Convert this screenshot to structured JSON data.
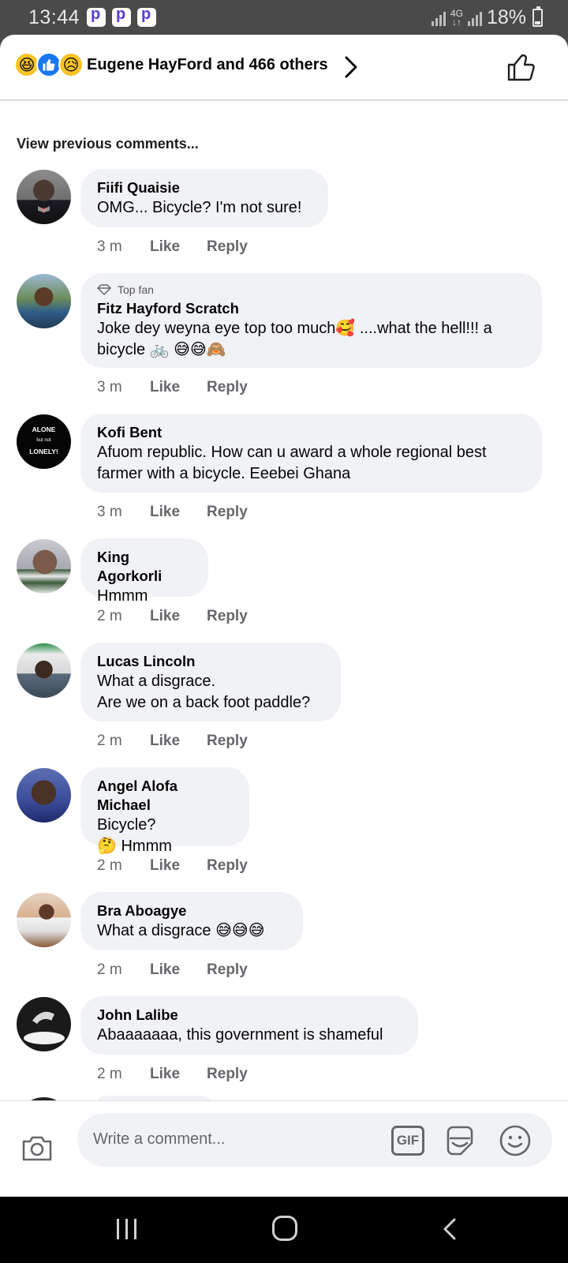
{
  "status_bar": {
    "time": "13:44",
    "network": "4G",
    "battery": "18%",
    "notification_icons": [
      "p-app-icon",
      "p-app-icon",
      "p-app-icon"
    ]
  },
  "reactions": {
    "emoji_icons": [
      "laugh-reaction-icon",
      "like-reaction-icon",
      "sad-reaction-icon"
    ],
    "summary": "Eugene HayFord and 466 others"
  },
  "view_previous": "View previous comments...",
  "comments": [
    {
      "name": "Fiifi Quaisie",
      "text": "OMG... Bicycle? I'm not sure!",
      "time": "3 m",
      "like": "Like",
      "reply": "Reply"
    },
    {
      "badge": "Top fan",
      "name": "Fitz Hayford Scratch",
      "text": "Joke dey weyna eye top too much🥰 ....what the hell!!! a bicycle 🚲 😅😅🙈",
      "time": "3 m",
      "like": "Like",
      "reply": "Reply"
    },
    {
      "name": "Kofi Bent",
      "text": "Afuom republic. How can u award a whole regional best farmer with a bicycle. Eeebei Ghana",
      "time": "3 m",
      "like": "Like",
      "reply": "Reply",
      "avatar_text": [
        "ALONE",
        "but not",
        "LONELY!"
      ]
    },
    {
      "name": "King Agorkorli",
      "text": "Hmmm",
      "time": "2 m",
      "like": "Like",
      "reply": "Reply"
    },
    {
      "name": "Lucas Lincoln",
      "text_lines": [
        "What a disgrace.",
        "Are we on a back foot paddle?"
      ],
      "time": "2 m",
      "like": "Like",
      "reply": "Reply"
    },
    {
      "name": "Angel Alofa Michael",
      "text_lines": [
        "Bicycle?",
        "🤔 Hmmm"
      ],
      "time": "2 m",
      "like": "Like",
      "reply": "Reply"
    },
    {
      "name": "Bra Aboagye",
      "text": "What a disgrace 😅😅😅",
      "time": "2 m",
      "like": "Like",
      "reply": "Reply"
    },
    {
      "name": "John Lalibe",
      "text": "Abaaaaaaa, this government is shameful",
      "time": "2 m",
      "like": "Like",
      "reply": "Reply"
    }
  ],
  "composer": {
    "placeholder": "Write a comment...",
    "gif_label": "GIF"
  }
}
